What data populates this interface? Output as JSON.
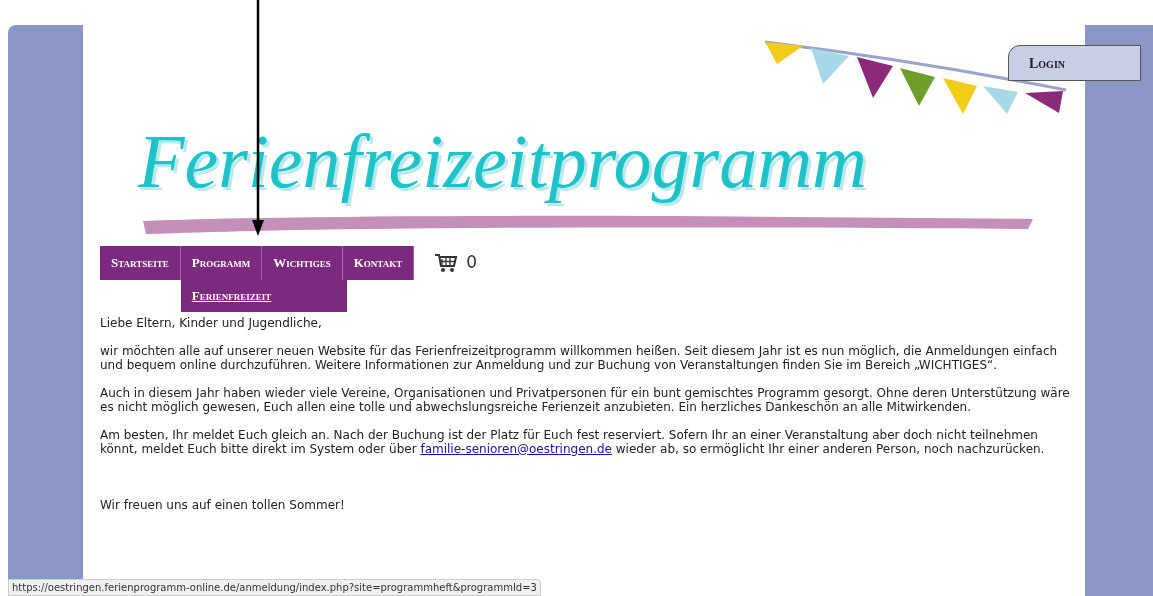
{
  "header": {
    "logo_text": "Ferienfreizeitprogramm",
    "login_button": "Login"
  },
  "nav": {
    "items": [
      {
        "label": "Startseite"
      },
      {
        "label": "Programm",
        "submenu": [
          {
            "label": "Ferienfreizeit"
          }
        ]
      },
      {
        "label": "Wichtiges"
      },
      {
        "label": "Kontakt"
      }
    ],
    "cart_count": "0"
  },
  "content": {
    "greeting": "Liebe Eltern, Kinder und Jugendliche,",
    "paragraphs": [
      {
        "text": "wir möchten alle auf unserer neuen Website für das Ferienfreizeitprogramm willkommen heißen. Seit diesem Jahr ist es nun möglich, die Anmeldungen einfach und bequem online durchzuführen. Weitere Informationen zur Anmeldung und zur Buchung von Veranstaltungen finden Sie im Bereich „WICHTIGES“."
      },
      {
        "text": "Auch in diesem Jahr haben wieder viele Vereine, Organisationen und Privatpersonen für ein bunt gemischtes Programm gesorgt. Ohne deren Unterstützung wäre es nicht möglich gewesen, Euch allen eine tolle und abwechslungsreiche Ferienzeit anzubieten. Ein herzliches Dankeschön an alle Mitwirkenden."
      },
      {
        "text": "Am besten, Ihr meldet Euch gleich an. Nach der Buchung ist der Platz für Euch fest reserviert. Sofern Ihr an einer Veranstaltung aber doch nicht teilnehmen könnt, meldet Euch bitte direkt im System oder über",
        "link": "familie-senioren@oestringen.de",
        "after": "wieder ab, so ermöglicht Ihr einer anderen Person, noch nachzurücken."
      }
    ],
    "closing": "Wir freuen uns auf einen tollen Sommer!"
  },
  "status_bar": "https://oestringen.ferienprogramm-online.de/anmeldung/index.php?site=programmheft&programmId=3"
}
